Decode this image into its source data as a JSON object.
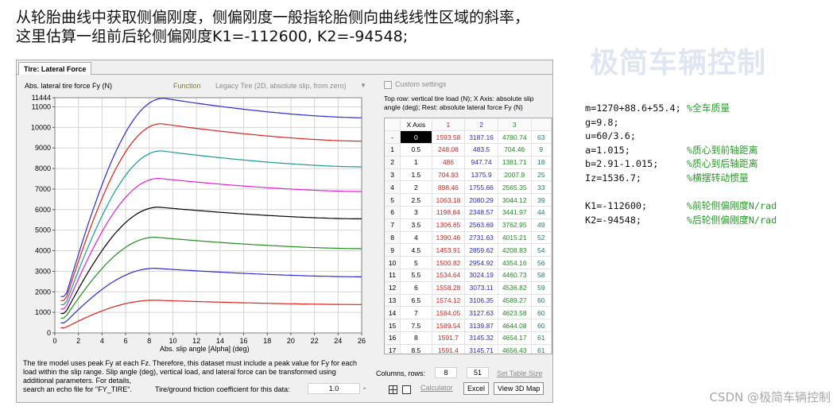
{
  "intro": {
    "line1": "从轮胎曲线中获取侧偏刚度，侧偏刚度一般指轮胎侧向曲线线性区域的斜率，",
    "line2": "这里估算一组前后轮侧偏刚度K1=-112600, K2=-94548;"
  },
  "tire_window": {
    "tab": "Tire: Lateral Force",
    "ylabel": "Abs. lateral tire force Fy (N)",
    "function_label": "Function",
    "function_value": "Legacy Tire (2D, absolute slip, from zero)",
    "custom_settings": "Custom settings",
    "table_note_line1": "Top row: vertical tire load (N); X Axis: absolute slip",
    "table_note_line2": "angle (deg); Rest: absolute lateral force Fy (N)",
    "xlabel": "Abs. slip angle [Alpha] (deg)",
    "description": [
      "The tire model uses peak Fy at each Fz. Therefore, this dataset must include a peak value for Fy for each",
      "load within the slip range. Slip angle (deg), vertical load, and lateral force can be transformed using",
      "additional parameters. For details,",
      "search an echo file for \"FY_TIRE\"."
    ],
    "friction_label": "Tire/ground friction coefficient for this data:",
    "friction_value": "1.0",
    "friction_dash": "-",
    "columns_rows_label": "Columns, rows:",
    "columns_value": "8",
    "rows_value": "51",
    "set_table_size": "Set Table Size",
    "calculator": "Calculator",
    "excel": "Excel",
    "view_3d_map": "View 3D Map",
    "grid_icon": "table-grid-icon",
    "window_icon": "window-icon"
  },
  "table": {
    "header": [
      "",
      "X Axis",
      "1",
      "2",
      "3",
      ""
    ],
    "rows": [
      [
        "-",
        "0",
        "1593.58",
        "3187.16",
        "4780.74",
        "63"
      ],
      [
        "1",
        "0.5",
        "248.08",
        "483.5",
        "704.46",
        "9"
      ],
      [
        "2",
        "1",
        "486",
        "947.74",
        "1381.71",
        "18"
      ],
      [
        "3",
        "1.5",
        "704.93",
        "1375.9",
        "2007.9",
        "25"
      ],
      [
        "4",
        "2",
        "898.46",
        "1755.66",
        "2565.35",
        "33"
      ],
      [
        "5",
        "2.5",
        "1063.18",
        "2080.29",
        "3044.12",
        "39"
      ],
      [
        "6",
        "3",
        "1198.64",
        "2348.57",
        "3441.97",
        "44"
      ],
      [
        "7",
        "3.5",
        "1306.65",
        "2563.69",
        "3762.95",
        "49"
      ],
      [
        "8",
        "4",
        "1390.46",
        "2731.63",
        "4015.21",
        "52"
      ],
      [
        "9",
        "4.5",
        "1453.91",
        "2859.62",
        "4208.83",
        "54"
      ],
      [
        "10",
        "5",
        "1500.82",
        "2954.92",
        "4354.16",
        "56"
      ],
      [
        "11",
        "5.5",
        "1534.64",
        "3024.19",
        "4460.73",
        "58"
      ],
      [
        "12",
        "6",
        "1558.28",
        "3073.11",
        "4536.82",
        "59"
      ],
      [
        "13",
        "6.5",
        "1574.12",
        "3106.35",
        "4589.27",
        "60"
      ],
      [
        "14",
        "7",
        "1584.05",
        "3127.63",
        "4623.58",
        "60"
      ],
      [
        "15",
        "7.5",
        "1589.54",
        "3139.87",
        "4644.08",
        "60"
      ],
      [
        "16",
        "8",
        "1591.7",
        "3145.32",
        "4654.17",
        "61"
      ],
      [
        "17",
        "8.5",
        "1591.4",
        "3145.71",
        "4656.43",
        "61"
      ]
    ]
  },
  "watermark": "极简车辆控制",
  "code": [
    {
      "code": "m=1270+88.6+55.4; ",
      "comment": "%全车质量"
    },
    {
      "code": "g=9.8;",
      "comment": ""
    },
    {
      "code": "u=60/3.6;",
      "comment": ""
    },
    {
      "code": "a=1.015;          ",
      "comment": "%质心到前轴距离"
    },
    {
      "code": "b=2.91-1.015;     ",
      "comment": "%质心到后轴距离"
    },
    {
      "code": "Iz=1536.7;        ",
      "comment": "%横摆转动惯量"
    },
    {
      "code": "",
      "comment": ""
    },
    {
      "code": "K1=-112600;       ",
      "comment": "%前轮侧偏刚度N/rad"
    },
    {
      "code": "K2=-94548;        ",
      "comment": "%后轮侧偏刚度N/rad"
    }
  ],
  "csdn": "CSDN @极简车辆控制",
  "chart_data": {
    "type": "line",
    "xlabel": "Abs. slip angle [Alpha] (deg)",
    "ylabel": "Abs. lateral tire force Fy (N)",
    "xlim": [
      0,
      26
    ],
    "ylim": [
      0,
      11444
    ],
    "xticks": [
      0,
      2,
      4,
      6,
      8,
      10,
      12,
      14,
      16,
      18,
      20,
      22,
      24,
      26
    ],
    "yticks": [
      0,
      1000,
      2000,
      3000,
      4000,
      5000,
      6000,
      7000,
      8000,
      9000,
      10000,
      11000,
      11444
    ],
    "grid": true,
    "series": [
      {
        "color": "#e0211d",
        "peak": 1592,
        "peak_x": 8.5,
        "end": 1380,
        "start": 0
      },
      {
        "color": "#2a2ad8",
        "peak": 3146,
        "peak_x": 8.5,
        "end": 2730,
        "start": 0
      },
      {
        "color": "#1f8e1f",
        "peak": 4656,
        "peak_x": 8.5,
        "end": 4100,
        "start": 0
      },
      {
        "color": "#000000",
        "peak": 6120,
        "peak_x": 8.8,
        "end": 5550,
        "start": 0
      },
      {
        "color": "#e020d8",
        "peak": 7520,
        "peak_x": 8.8,
        "end": 6880,
        "start": 0
      },
      {
        "color": "#1b9a92",
        "peak": 8860,
        "peak_x": 9.0,
        "end": 8080,
        "start": 0
      },
      {
        "color": "#e0211d",
        "peak": 10180,
        "peak_x": 9.0,
        "end": 9330,
        "start": 0
      },
      {
        "color": "#2a2ad8",
        "peak": 11420,
        "peak_x": 9.2,
        "end": 10470,
        "start": 0
      }
    ]
  }
}
